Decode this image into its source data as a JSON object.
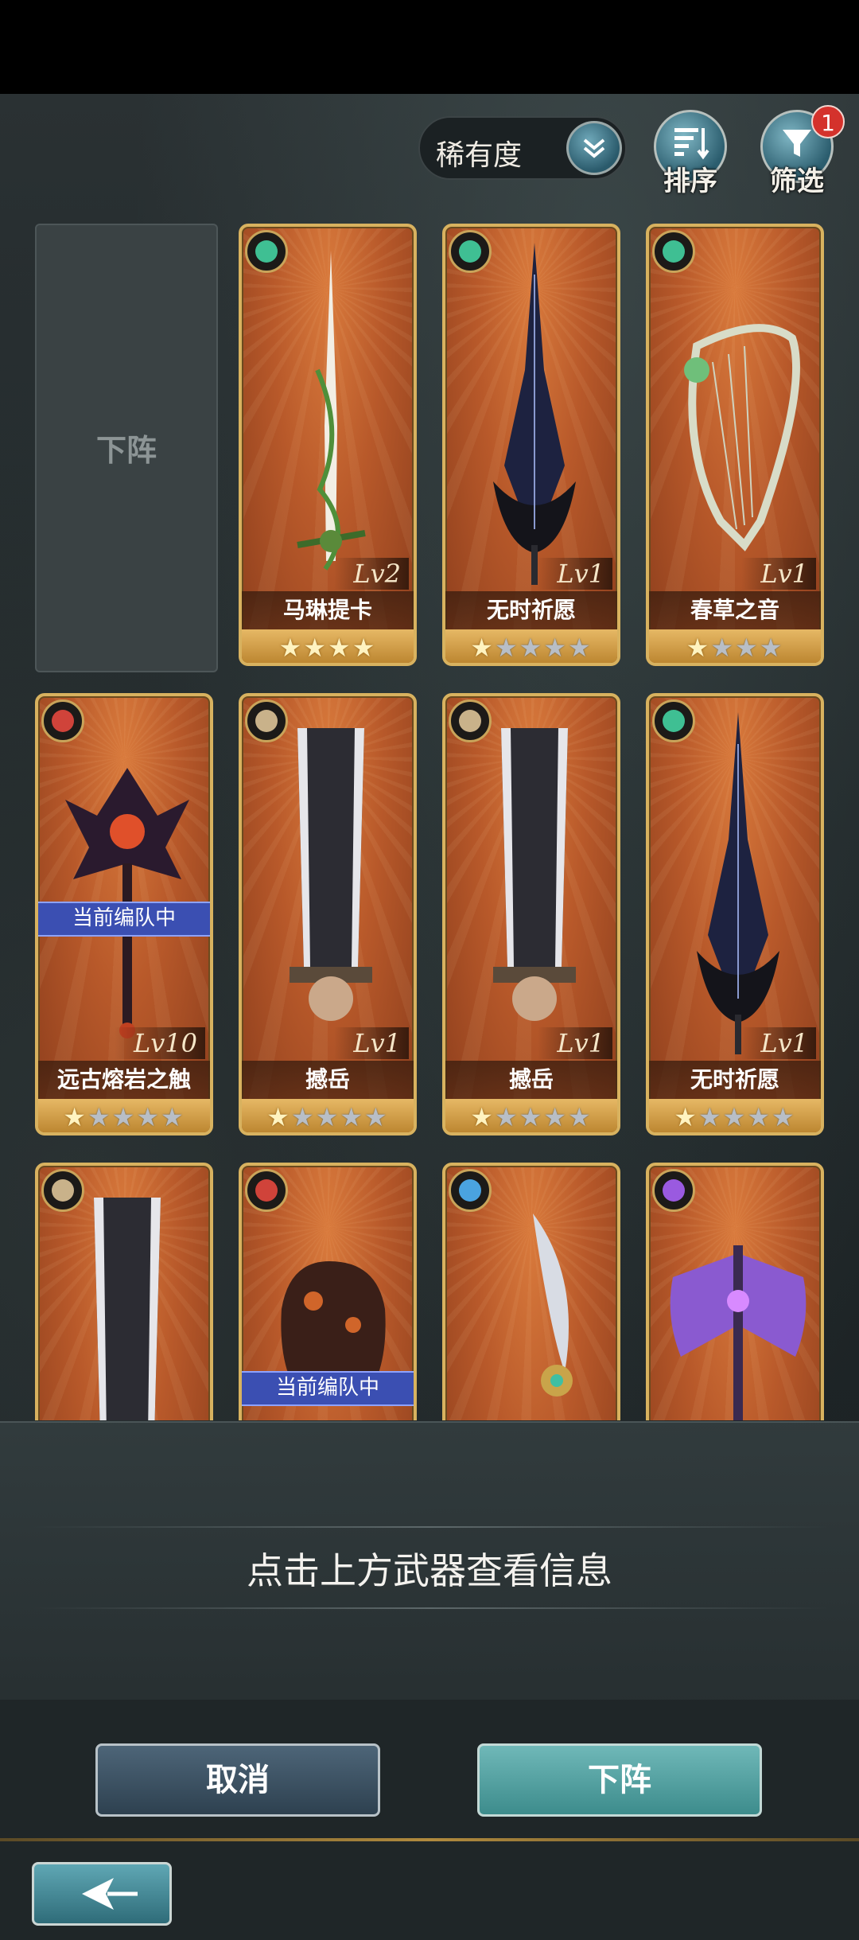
{
  "toolbar": {
    "sort_select": {
      "label": "稀有度"
    },
    "sort_button_label": "排序",
    "filter_button_label": "筛选",
    "filter_badge": "1"
  },
  "unequip_slot_label": "下阵",
  "weapons": [
    {
      "name": "马琳提卡",
      "level": "Lv2",
      "element": "wind",
      "element_color": "#3fbf93",
      "stars_total": 4,
      "stars_filled": 4,
      "team_banner": ""
    },
    {
      "name": "无时祈愿",
      "level": "Lv1",
      "element": "wind",
      "element_color": "#3fbf93",
      "stars_total": 5,
      "stars_filled": 1,
      "team_banner": ""
    },
    {
      "name": "春草之音",
      "level": "Lv1",
      "element": "wind",
      "element_color": "#3fbf93",
      "stars_total": 4,
      "stars_filled": 1,
      "team_banner": ""
    },
    {
      "name": "远古熔岩之触",
      "level": "Lv10",
      "element": "fire",
      "element_color": "#d0433a",
      "stars_total": 5,
      "stars_filled": 1,
      "team_banner": "当前编队中"
    },
    {
      "name": "撼岳",
      "level": "Lv1",
      "element": "earth",
      "element_color": "#c9b28a",
      "stars_total": 5,
      "stars_filled": 1,
      "team_banner": ""
    },
    {
      "name": "撼岳",
      "level": "Lv1",
      "element": "earth",
      "element_color": "#c9b28a",
      "stars_total": 5,
      "stars_filled": 1,
      "team_banner": ""
    },
    {
      "name": "无时祈愿",
      "level": "Lv1",
      "element": "wind",
      "element_color": "#3fbf93",
      "stars_total": 5,
      "stars_filled": 1,
      "team_banner": ""
    },
    {
      "name": "",
      "level": "",
      "element": "earth",
      "element_color": "#c9b28a",
      "stars_total": 0,
      "stars_filled": 0,
      "team_banner": ""
    },
    {
      "name": "",
      "level": "",
      "element": "fire",
      "element_color": "#d0433a",
      "stars_total": 0,
      "stars_filled": 0,
      "team_banner": "当前编队中"
    },
    {
      "name": "",
      "level": "",
      "element": "water",
      "element_color": "#4aa3e0",
      "stars_total": 0,
      "stars_filled": 0,
      "team_banner": ""
    },
    {
      "name": "",
      "level": "",
      "element": "dark",
      "element_color": "#9a5ae0",
      "stars_total": 0,
      "stars_filled": 0,
      "team_banner": ""
    }
  ],
  "info_panel": {
    "hint": "点击上方武器查看信息"
  },
  "actions": {
    "cancel_label": "取消",
    "confirm_label": "下阵"
  },
  "colors": {
    "card_border": "#d8b25f",
    "card_bg": "#b8592a",
    "team_banner": "#3b4fb2",
    "confirm": "#4f9e9e",
    "cancel": "#3a5162"
  }
}
